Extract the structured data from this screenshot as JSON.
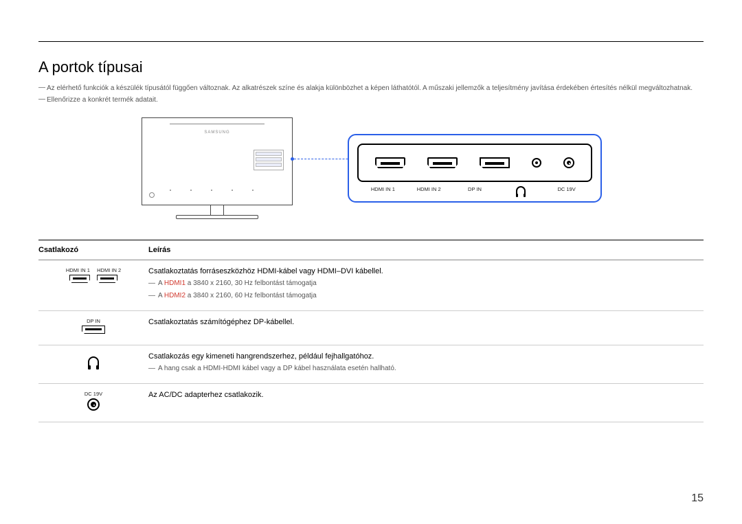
{
  "page": {
    "title": "A portok típusai",
    "note1": "Az elérhető funkciók a készülék típusától függően változnak. Az alkatrészek színe és alakja különbözhet a képen láthatótól. A műszaki jellemzők a teljesítmény javítása érdekében értesítés nélkül megváltozhatnak.",
    "note2": "Ellenőrizze a konkrét termék adatait.",
    "page_number": "15",
    "monitor_logo": "SAMSUNG"
  },
  "panel_labels": {
    "hdmi1": "HDMI IN 1",
    "hdmi2": "HDMI IN 2",
    "dp": "DP IN",
    "headphone_icon": "headphones",
    "dc": "DC 19V"
  },
  "table": {
    "header_port": "Csatlakozó",
    "header_desc": "Leírás",
    "rows": [
      {
        "labels": [
          "HDMI IN 1",
          "HDMI IN 2"
        ],
        "desc": "Csatlakoztatás forráseszközhöz HDMI-kábel vagy HDMI–DVI kábellel.",
        "notes": [
          {
            "prefix": "A ",
            "red": "HDMI1",
            "rest": " a 3840 x 2160, 30 Hz felbontást támogatja"
          },
          {
            "prefix": "A ",
            "red": "HDMI2",
            "rest": " a 3840 x 2160, 60 Hz felbontást támogatja"
          }
        ]
      },
      {
        "labels": [
          "DP IN"
        ],
        "desc": "Csatlakoztatás számítógéphez DP-kábellel."
      },
      {
        "labels": [],
        "desc": "Csatlakozás egy kimeneti hangrendszerhez, például fejhallgatóhoz.",
        "notes_plain": [
          "A hang csak a HDMI-HDMI kábel vagy a DP kábel használata esetén hallható."
        ]
      },
      {
        "labels": [
          "DC 19V"
        ],
        "desc": "Az AC/DC adapterhez csatlakozik."
      }
    ]
  }
}
